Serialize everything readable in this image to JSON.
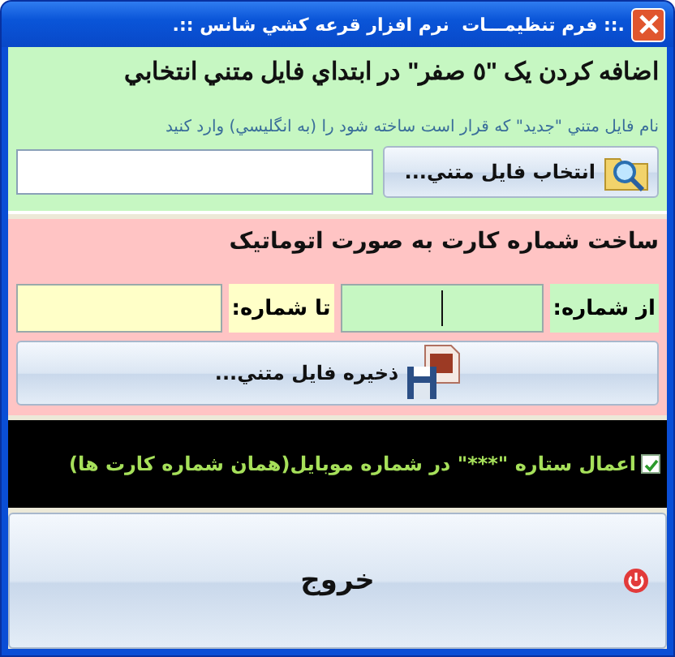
{
  "window": {
    "title": ".:: فرم تنظیمـــات  نرم افزار قرعه کشي شانس ::."
  },
  "zero_prefix_section": {
    "heading": "اضافه کردن یک \"٥ صفر\" در ابتداي فایل متني انتخابي",
    "hint": "نام فایل متني \"جدید\" که قرار است ساخته شود را (به انگلیسي) وارد کنید",
    "browse_button": "انتخاب فایل متني..."
  },
  "card_number_section": {
    "heading": "ساخت شماره کارت به صورت اتوماتیک",
    "from_label": "از شماره:",
    "from_field": {
      "focused": true
    },
    "to_label": "تا شماره:",
    "save_button": "ذخیره فایل متني..."
  },
  "mask_option": {
    "label": "اعمال ستاره \"***\" در شماره موبایل(همان شماره کارت ها)",
    "checked": true
  },
  "exit_button": "خروج"
}
